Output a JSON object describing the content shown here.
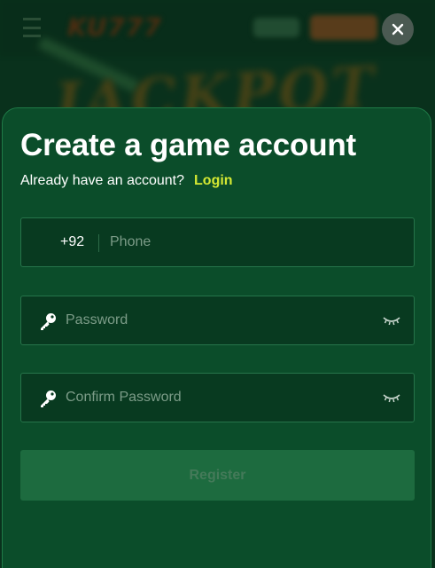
{
  "background": {
    "logo_text": "KU777",
    "banner_text": "JACKPOT"
  },
  "modal": {
    "title": "Create a game account",
    "login_prompt": "Already have an account?",
    "login_link": "Login",
    "phone": {
      "country_code": "+92",
      "placeholder": "Phone",
      "value": ""
    },
    "password": {
      "placeholder": "Password",
      "value": ""
    },
    "confirm_password": {
      "placeholder": "Confirm Password",
      "value": ""
    },
    "register_label": "Register"
  },
  "colors": {
    "modal_bg": "#0b4d2a",
    "field_bg": "#083a20",
    "link_accent": "#d4e833",
    "register_bg": "#1d6b3f"
  },
  "icons": {
    "close": "close-icon",
    "field_prefix": "key-icon",
    "field_toggle": "eye-closed-icon"
  }
}
